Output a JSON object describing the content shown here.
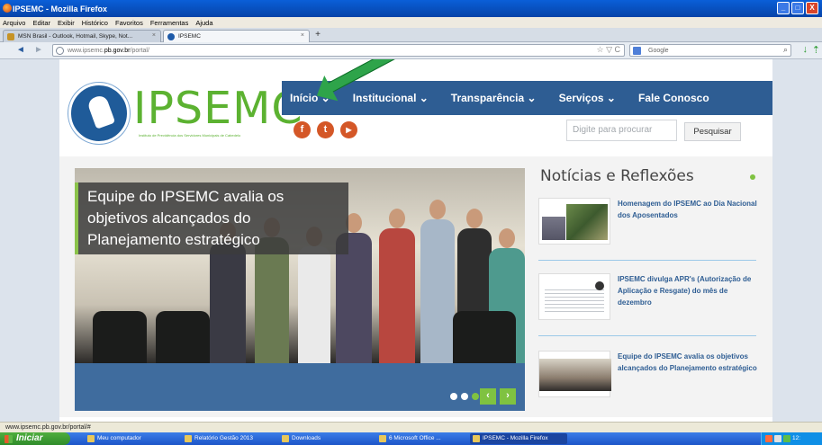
{
  "window": {
    "title": "IPSEMC - Mozilla Firefox",
    "buttons": [
      "_",
      "□",
      "X"
    ]
  },
  "menu": [
    "Arquivo",
    "Editar",
    "Exibir",
    "Histórico",
    "Favoritos",
    "Ferramentas",
    "Ajuda"
  ],
  "tabs": [
    {
      "label": "MSN Brasil - Outlook, Hotmail, Skype, Not...",
      "close": "×"
    },
    {
      "label": "IPSEMC",
      "close": "×"
    }
  ],
  "newtab": "+",
  "nav": {
    "back": "◄",
    "forward": "►",
    "url_prefix": "www.ipsemc.",
    "url_domain": "pb.gov.br",
    "url_suffix": "/portal/",
    "url_icons": "☆ ▽ C",
    "search_engine": "Google",
    "search_icon": "⌕",
    "download_icon": "↓",
    "home_icon": "⇡"
  },
  "site": {
    "brand": "IPSEMC",
    "tagline": "Instituto de Previdência dos Servidores Municipais de Cabedelo",
    "menu": [
      "Início ⌄",
      "Institucional ⌄",
      "Transparência ⌄",
      "Serviços ⌄",
      "Fale Conosco"
    ],
    "social": [
      {
        "icon": "facebook-icon",
        "glyph": "f",
        "color": "#d45727"
      },
      {
        "icon": "twitter-icon",
        "glyph": "t",
        "color": "#d45727"
      },
      {
        "icon": "youtube-icon",
        "glyph": "▶",
        "color": "#d45727"
      }
    ],
    "search_placeholder": "Digite para procurar",
    "search_button": "Pesquisar",
    "slide": {
      "caption_lines": [
        "Equipe do IPSEMC avalia os",
        "objetivos alcançados do",
        "Planejamento estratégico"
      ],
      "prev": "‹",
      "next": "›"
    },
    "news_heading": "Notícias e Reflexões",
    "news": [
      {
        "title": "Homenagem do IPSEMC ao Dia Nacional dos Aposentados"
      },
      {
        "title": "IPSEMC divulga APR's (Autorização de Aplicação e Resgate) do mês de dezembro"
      },
      {
        "title": "Equipe do IPSEMC avalia os objetivos alcançados do Planejamento estratégico"
      }
    ]
  },
  "status_text": "www.ipsemc.pb.gov.br/portal/#",
  "taskbar": {
    "start": "Iniciar",
    "items": [
      {
        "label": "Meu computador"
      },
      {
        "label": "Relatório Gestão 2013"
      },
      {
        "label": "Downloads"
      },
      {
        "label": "6 Microsoft Office ..."
      },
      {
        "label": "IPSEMC - Mozilla Firefox"
      }
    ],
    "clock": "12:"
  },
  "colors": {
    "nav_blue": "#2e5d93",
    "brand_green": "#5cb231",
    "accent_green": "#7fc241",
    "social_orange": "#d45727"
  }
}
